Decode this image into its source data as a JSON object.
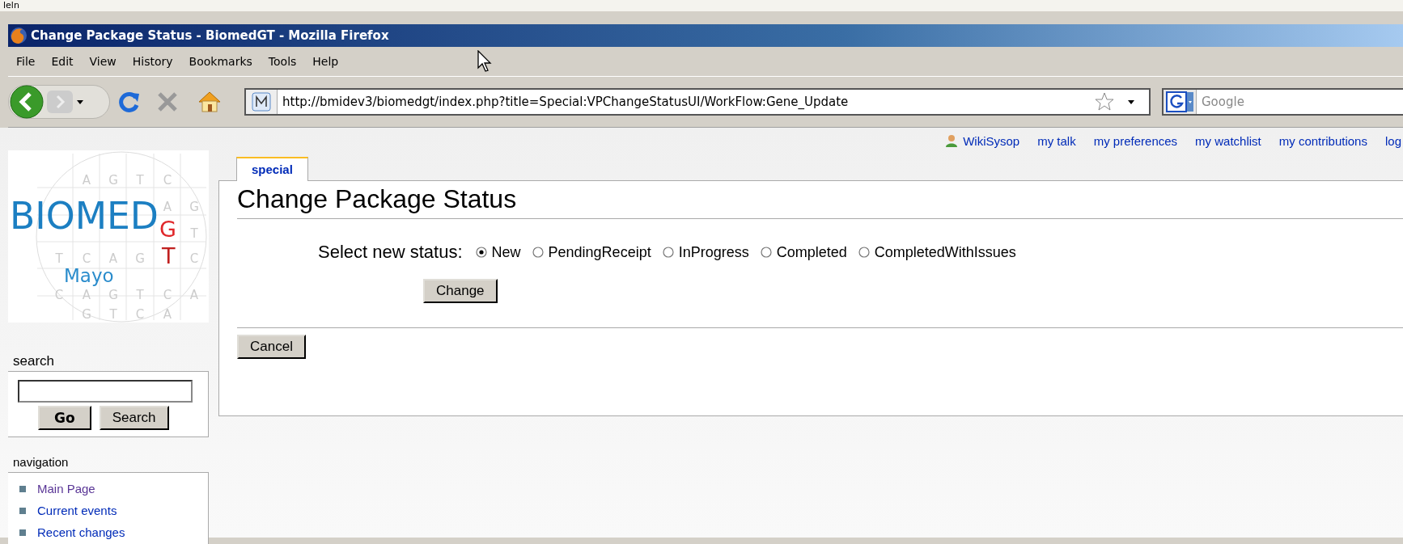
{
  "top_strip": {
    "text": "leln"
  },
  "window": {
    "title": "Change Package Status - BiomedGT - Mozilla Firefox"
  },
  "menu": [
    "File",
    "Edit",
    "View",
    "History",
    "Bookmarks",
    "Tools",
    "Help"
  ],
  "toolbar": {
    "url": "http://bmidev3/biomedgt/index.php?title=Special:VPChangeStatusUI/WorkFlow:Gene_Update",
    "search_placeholder": "Google"
  },
  "personal": {
    "user": "WikiSysop",
    "links": [
      "my talk",
      "my preferences",
      "my watchlist",
      "my contributions",
      "log"
    ]
  },
  "logo": {
    "title": "BIOMED",
    "sub1": "G",
    "sub2": "T",
    "org": "Mayo",
    "grid": [
      [
        "A",
        "G",
        "T",
        "C"
      ],
      [
        "A",
        "G"
      ],
      [
        "T"
      ],
      [
        "T",
        "C",
        "A",
        "G",
        "C"
      ],
      [
        "C",
        "A",
        "G",
        "T",
        "C",
        "A"
      ],
      [
        "G",
        "T",
        "C",
        "A"
      ]
    ]
  },
  "sidebar": {
    "search_title": "search",
    "go": "Go",
    "search": "Search",
    "nav_title": "navigation",
    "nav": [
      {
        "label": "Main Page",
        "visited": true
      },
      {
        "label": "Current events",
        "visited": false
      },
      {
        "label": "Recent changes",
        "visited": false
      }
    ]
  },
  "tab": {
    "label": "special",
    "selected": true
  },
  "heading": "Change Package Status",
  "form": {
    "label": "Select new status:",
    "options": [
      {
        "label": "New",
        "selected": true
      },
      {
        "label": "PendingReceipt",
        "selected": false
      },
      {
        "label": "InProgress",
        "selected": false
      },
      {
        "label": "Completed",
        "selected": false
      },
      {
        "label": "CompletedWithIssues",
        "selected": false
      }
    ],
    "submit": "Change",
    "cancel": "Cancel"
  }
}
